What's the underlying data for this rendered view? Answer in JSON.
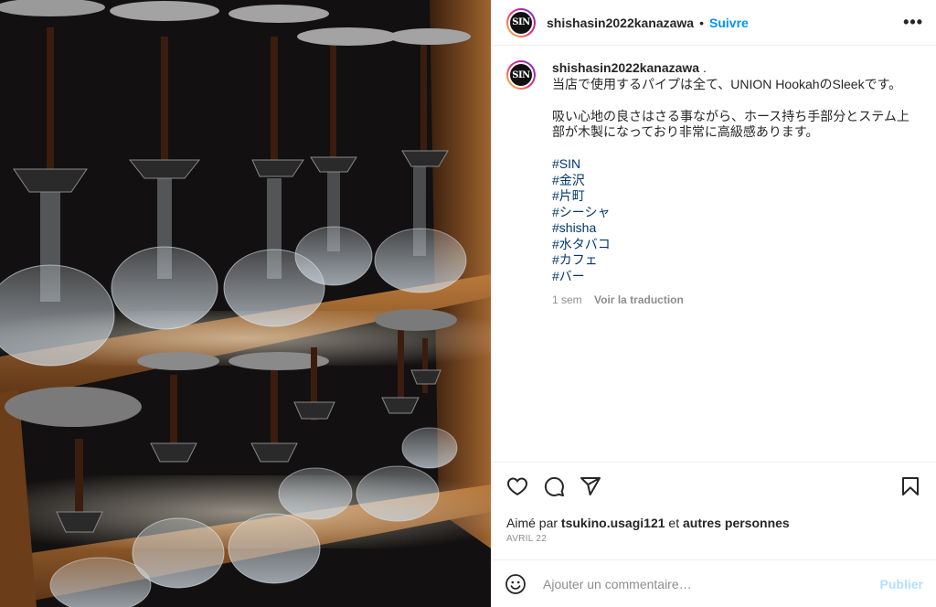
{
  "header": {
    "username": "shishasin2022kanazawa",
    "separator": "•",
    "follow_label": "Suivre",
    "more_label": "•••",
    "avatar_text": "SIN"
  },
  "caption": {
    "username": "shishasin2022kanazawa",
    "user_suffix": ".",
    "line1": "当店で使用するパイプは全て、UNION HookahのSleekです。",
    "line2": "吸い心地の良さはさる事ながら、ホース持ち手部分とステム上部が木製になっており非常に高級感あります。",
    "hashtags": [
      "#SIN",
      "#金沢",
      "#片町",
      "#シーシャ",
      "#shisha",
      "#水タバコ",
      "#カフェ",
      "#バー"
    ],
    "time": "1 sem",
    "translate_label": "Voir la traduction"
  },
  "likes": {
    "prefix": "Aimé par",
    "user": "tsukino.usagi121",
    "middle": "et",
    "others": "autres personnes"
  },
  "date": "AVRIL 22",
  "comment": {
    "placeholder": "Ajouter un commentaire…",
    "post_label": "Publier"
  },
  "icons": {
    "like": "heart-icon",
    "comment": "comment-icon",
    "share": "send-icon",
    "save": "bookmark-icon",
    "emoji": "emoji-icon"
  },
  "colors": {
    "link_blue": "#0095f6",
    "hashtag": "#00376b",
    "muted": "#8e8e8e",
    "post_disabled": "#b2dffc"
  }
}
